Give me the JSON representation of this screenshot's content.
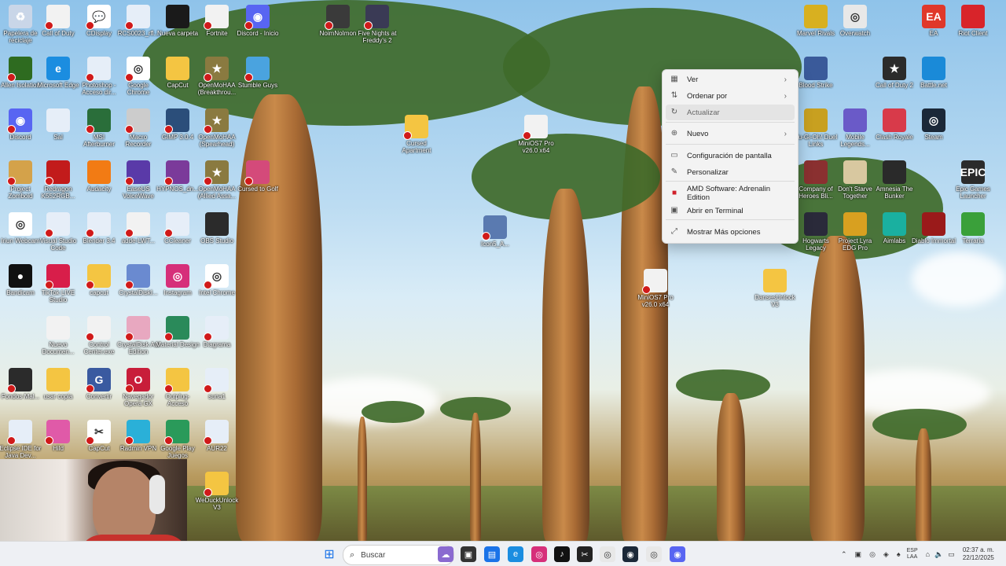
{
  "desktop_icons": [
    {
      "label": "Papelera de reciclaje",
      "color": "#c9d6e8",
      "glyph": "♻",
      "x": false
    },
    {
      "label": "Call of Duty",
      "color": "#f2f2f2",
      "glyph": "",
      "x": true
    },
    {
      "label": "CDisplay",
      "color": "#ffffff",
      "glyph": "💬",
      "x": true
    },
    {
      "label": "RCS0023_rfl...",
      "color": "#e6eef8",
      "glyph": "",
      "x": true
    },
    {
      "label": "Nueva carpeta",
      "color": "#1a1a1a",
      "glyph": "",
      "x": false
    },
    {
      "label": "Fortnite",
      "color": "#f2f2f2",
      "glyph": "",
      "x": true
    },
    {
      "label": "Discord - Inicio",
      "color": "#5865f2",
      "glyph": "◉",
      "x": true
    },
    {
      "label": "NoimNoImon",
      "color": "#3a3a3a",
      "glyph": "",
      "x": true
    },
    {
      "label": "Five Nights at Freddy's 2",
      "color": "#3a3a55",
      "glyph": "",
      "x": true
    },
    {
      "label": "Allen Isolation",
      "color": "#2e6b20",
      "glyph": "",
      "x": true
    },
    {
      "label": "Microsoft Edge",
      "color": "#1b8de0",
      "glyph": "e",
      "x": false
    },
    {
      "label": "Photoshop - Acceso dir...",
      "color": "#e6eef8",
      "glyph": "",
      "x": true
    },
    {
      "label": "Google Chrome",
      "color": "#ffffff",
      "glyph": "◎",
      "x": true
    },
    {
      "label": "CapCut",
      "color": "#f4c542",
      "glyph": "",
      "x": false
    },
    {
      "label": "OpenMoHAA (Breakthrou...",
      "color": "#8a7a40",
      "glyph": "★",
      "x": true
    },
    {
      "label": "Stumble Guys",
      "color": "#4aa3df",
      "glyph": "",
      "x": true
    },
    {
      "label": "Discord",
      "color": "#5865f2",
      "glyph": "◉",
      "x": true
    },
    {
      "label": "Sal",
      "color": "#e6eef8",
      "glyph": "",
      "x": false
    },
    {
      "label": "MSI Afterburner",
      "color": "#2a6e3a",
      "glyph": "",
      "x": true
    },
    {
      "label": "Macro Recorder",
      "color": "#cccccc",
      "glyph": "",
      "x": true
    },
    {
      "label": "GIMP 3.0.4",
      "color": "#2b4e7a",
      "glyph": "",
      "x": true
    },
    {
      "label": "OpenMoHAA (Spearhead)",
      "color": "#8a7a40",
      "glyph": "★",
      "x": true
    },
    {
      "label": "Project Zomboid",
      "color": "#d4a24a",
      "glyph": "",
      "x": true
    },
    {
      "label": "Redragon K552RGB...",
      "color": "#c21b1b",
      "glyph": "",
      "x": true
    },
    {
      "label": "Audacity",
      "color": "#f27b14",
      "glyph": "",
      "x": false
    },
    {
      "label": "EaseUS VoiceWave",
      "color": "#5a3aa8",
      "glyph": "",
      "x": true
    },
    {
      "label": "HYPNOS_dn...",
      "color": "#7b3a9a",
      "glyph": "",
      "x": true
    },
    {
      "label": "OpenMoHAA (Allied Assa...",
      "color": "#8a7a40",
      "glyph": "★",
      "x": true
    },
    {
      "label": "Cursed to Golf",
      "color": "#d44a7a",
      "glyph": "",
      "x": true
    },
    {
      "label": "Iriun Webcam",
      "color": "#ffffff",
      "glyph": "◎",
      "x": false
    },
    {
      "label": "Visual Studio Code",
      "color": "#e6eef8",
      "glyph": "",
      "x": true
    },
    {
      "label": "Blender 3.4",
      "color": "#e6eef8",
      "glyph": "",
      "x": true
    },
    {
      "label": "adde-LWT...",
      "color": "#f2f2f2",
      "glyph": "",
      "x": true
    },
    {
      "label": "CCleaner",
      "color": "#e6eef8",
      "glyph": "",
      "x": true
    },
    {
      "label": "OBS Studio",
      "color": "#2b2b2b",
      "glyph": "",
      "x": false
    },
    {
      "label": "Bandicam",
      "color": "#111111",
      "glyph": "●",
      "x": false
    },
    {
      "label": "TikTok LIVE Studio",
      "color": "#d81e4a",
      "glyph": "",
      "x": true
    },
    {
      "label": "capcut",
      "color": "#f4c542",
      "glyph": "",
      "x": true
    },
    {
      "label": "CrystalDiskI...",
      "color": "#6a8ad0",
      "glyph": "",
      "x": true
    },
    {
      "label": "Instagram",
      "color": "#d62f7a",
      "glyph": "◎",
      "x": false
    },
    {
      "label": "Intel Chrome",
      "color": "#ffffff",
      "glyph": "◎",
      "x": true
    },
    {
      "label": "Nuevo Documen...",
      "color": "#f2f2f2",
      "glyph": "",
      "x": false
    },
    {
      "label": "Control Center.exe",
      "color": "#f2f2f2",
      "glyph": "",
      "x": true
    },
    {
      "label": "CrystalDisk Aoi Edition",
      "color": "#e8a8c0",
      "glyph": "",
      "x": true
    },
    {
      "label": "Material Design",
      "color": "#2a8a5a",
      "glyph": "",
      "x": true
    },
    {
      "label": "Diagrama",
      "color": "#e6eef8",
      "glyph": "",
      "x": true
    },
    {
      "label": "Fondos Mal...",
      "color": "#2b2b2b",
      "glyph": "",
      "x": true
    },
    {
      "label": "usar copia",
      "color": "#f4c542",
      "glyph": "",
      "x": false
    },
    {
      "label": "Convertir",
      "color": "#3a5aa0",
      "glyph": "G",
      "x": true
    },
    {
      "label": "Navegador Opera GX",
      "color": "#c81e3a",
      "glyph": "O",
      "x": true
    },
    {
      "label": "Outplug-Acceso",
      "color": "#f4c542",
      "glyph": "",
      "x": true
    },
    {
      "label": "suna1",
      "color": "#e6eef8",
      "glyph": "",
      "x": true
    },
    {
      "label": "Eclipse IDE for Java Dev...",
      "color": "#e6eef8",
      "glyph": "",
      "x": true
    },
    {
      "label": "Hild",
      "color": "#e05aa8",
      "glyph": "",
      "x": true
    },
    {
      "label": "CapCut",
      "color": "#ffffff",
      "glyph": "✂",
      "x": true
    },
    {
      "label": "Radmin VPN",
      "color": "#2ab0d8",
      "glyph": "",
      "x": true
    },
    {
      "label": "Google Play Juegos",
      "color": "#2a9a5a",
      "glyph": "",
      "x": true
    },
    {
      "label": "AUR22",
      "color": "#e6eef8",
      "glyph": "",
      "x": true
    },
    {
      "label": "Cursed Apartment",
      "color": "#f4c542",
      "glyph": "",
      "x": true
    },
    {
      "label": "MiniOS7 Pro v26.0 x64",
      "color": "#f2f2f2",
      "glyph": "",
      "x": true
    },
    {
      "label": "Icon5_A...",
      "color": "#5a7ab0",
      "glyph": "",
      "x": true
    },
    {
      "label": "MiniOS7 Pro v26.0 x64",
      "color": "#f2f2f2",
      "glyph": "",
      "x": true
    },
    {
      "label": "DansesUnlock V3",
      "color": "#f4c542",
      "glyph": "",
      "x": false
    },
    {
      "label": "WeDuckUnlock V3",
      "color": "#f4c542",
      "glyph": "",
      "x": true
    },
    {
      "label": "Marvel Rivals",
      "color": "#d8b020",
      "glyph": "",
      "x": false
    },
    {
      "label": "Overwatch",
      "color": "#e8e8e8",
      "glyph": "◎",
      "x": false
    },
    {
      "label": "EA",
      "color": "#e0382a",
      "glyph": "EA",
      "x": false
    },
    {
      "label": "Riot Client",
      "color": "#d8242a",
      "glyph": "",
      "x": false
    },
    {
      "label": "Blood Strike",
      "color": "#3a5a9a",
      "glyph": "",
      "x": false
    },
    {
      "label": "Call of Duty 2",
      "color": "#2b2b2b",
      "glyph": "★",
      "x": false
    },
    {
      "label": "Battle.net",
      "color": "#1a8ad8",
      "glyph": "",
      "x": false
    },
    {
      "label": "Yu-Gi-Oh! Duel Links",
      "color": "#c8a020",
      "glyph": "",
      "x": false
    },
    {
      "label": "Mobile Legends...",
      "color": "#6a5ac8",
      "glyph": "",
      "x": false
    },
    {
      "label": "Clash Royale",
      "color": "#d83a4a",
      "glyph": "",
      "x": false
    },
    {
      "label": "Steam",
      "color": "#1b2838",
      "glyph": "◎",
      "x": false
    },
    {
      "label": "Company of Heroes Bli...",
      "color": "#8a3030",
      "glyph": "",
      "x": false
    },
    {
      "label": "Don't Starve Together",
      "color": "#d8c8a0",
      "glyph": "",
      "x": false
    },
    {
      "label": "Amnesia The Bunker",
      "color": "#2a2a2a",
      "glyph": "",
      "x": false
    },
    {
      "label": "Epic Games Launcher",
      "color": "#2b2b2b",
      "glyph": "EPIC",
      "x": false
    },
    {
      "label": "Hogwarts Legacy",
      "color": "#2a2a3a",
      "glyph": "",
      "x": false
    },
    {
      "label": "Project Lyra EDG Pro",
      "color": "#d8a020",
      "glyph": "",
      "x": false
    },
    {
      "label": "Aimlabs",
      "color": "#1ab0a0",
      "glyph": "",
      "x": false
    },
    {
      "label": "Diablo Immortal",
      "color": "#9a1a1a",
      "glyph": "",
      "x": false
    },
    {
      "label": "Terraria",
      "color": "#3aa03a",
      "glyph": "",
      "x": false
    }
  ],
  "context_menu": {
    "items": [
      {
        "label": "Ver",
        "icon": "grid-icon",
        "arrow": true,
        "hover": false
      },
      {
        "label": "Ordenar por",
        "icon": "sort-icon",
        "arrow": true,
        "hover": false
      },
      {
        "label": "Actualizar",
        "icon": "refresh-icon",
        "arrow": false,
        "hover": true
      },
      {
        "label": "Nuevo",
        "icon": "plus-circle-icon",
        "arrow": true,
        "hover": false
      },
      {
        "label": "Configuración de pantalla",
        "icon": "display-icon",
        "arrow": false,
        "hover": false
      },
      {
        "label": "Personalizar",
        "icon": "pen-icon",
        "arrow": false,
        "hover": false
      },
      {
        "label": "AMD Software: Adrenalin Edition",
        "icon": "amd-icon",
        "arrow": false,
        "hover": false
      },
      {
        "label": "Abrir en Terminal",
        "icon": "terminal-icon",
        "arrow": false,
        "hover": false
      },
      {
        "label": "Mostrar Más opciones",
        "icon": "expand-icon",
        "arrow": false,
        "hover": false
      }
    ]
  },
  "taskbar": {
    "search_placeholder": "Buscar",
    "apps": [
      {
        "name": "start-button",
        "color": "#1a73e8"
      },
      {
        "name": "widgets",
        "color": "#8a6ad0"
      },
      {
        "name": "terminal",
        "color": "#333333"
      },
      {
        "name": "file-explorer",
        "color": "#1a73e8"
      },
      {
        "name": "edge",
        "color": "#1b8de0"
      },
      {
        "name": "instagram",
        "color": "#d62f7a"
      },
      {
        "name": "tiktok",
        "color": "#111111"
      },
      {
        "name": "capcut",
        "color": "#222222"
      },
      {
        "name": "chrome",
        "color": "#e8e8e8"
      },
      {
        "name": "steam",
        "color": "#1b2838"
      },
      {
        "name": "chrome-2",
        "color": "#e8e8e8"
      },
      {
        "name": "discord",
        "color": "#5865f2"
      }
    ],
    "lang_top": "ESP",
    "lang_bottom": "LAA",
    "time": "02:37 a. m.",
    "date": "22/12/2025"
  }
}
